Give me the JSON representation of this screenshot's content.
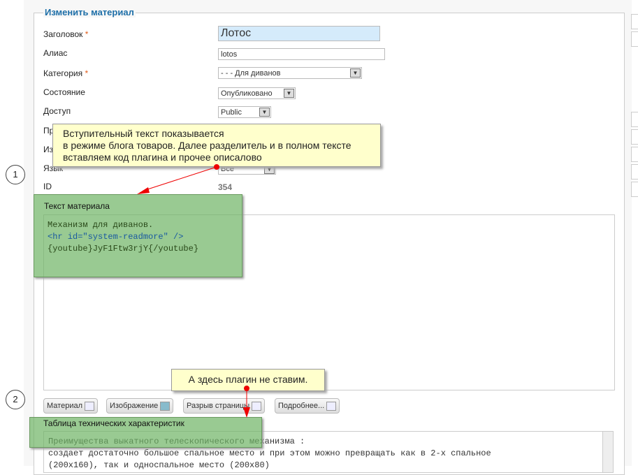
{
  "form": {
    "legend": "Изменить материал",
    "title_label": "Заголовок",
    "title_value": "Лотос",
    "alias_label": "Алиас",
    "alias_value": "lotos",
    "category_label": "Категория",
    "category_value": "- - - Для диванов",
    "state_label": "Состояние",
    "state_value": "Опубликовано",
    "access_label": "Доступ",
    "access_value": "Public",
    "perm_label": "Пр",
    "featured_label": "Из",
    "lang_label": "Язык",
    "lang_value": "Все",
    "id_label": "ID",
    "id_value": "354",
    "required_mark": "*",
    "text_label": "Текст материала",
    "code_lines": [
      "Механизм для диванов.",
      "<hr id=\"system-readmore\" />",
      "{youtube}JyF1Ftw3rjY{/youtube}"
    ],
    "buttons": [
      "Материал",
      "Изображение",
      "Разрыв страницы",
      "Подробнее..."
    ],
    "specs_label": "Таблица технических характеристик",
    "specs_lines": [
      "Преимущества выкатного телескопического механизма :",
      "создает достаточно большое спальное место и при этом можно превращать как в 2-х спальное",
      "(200x160), так и односпальное место (200x80)"
    ]
  },
  "annotations": {
    "note1": [
      "Вступительный текст показывается",
      "в режиме блога товаров. Далее разделитель и в полном тексте",
      "вставляем код плагина и прочее описалово"
    ],
    "note2": "А здесь плагин не ставим.",
    "step1": "1",
    "step2": "2"
  }
}
